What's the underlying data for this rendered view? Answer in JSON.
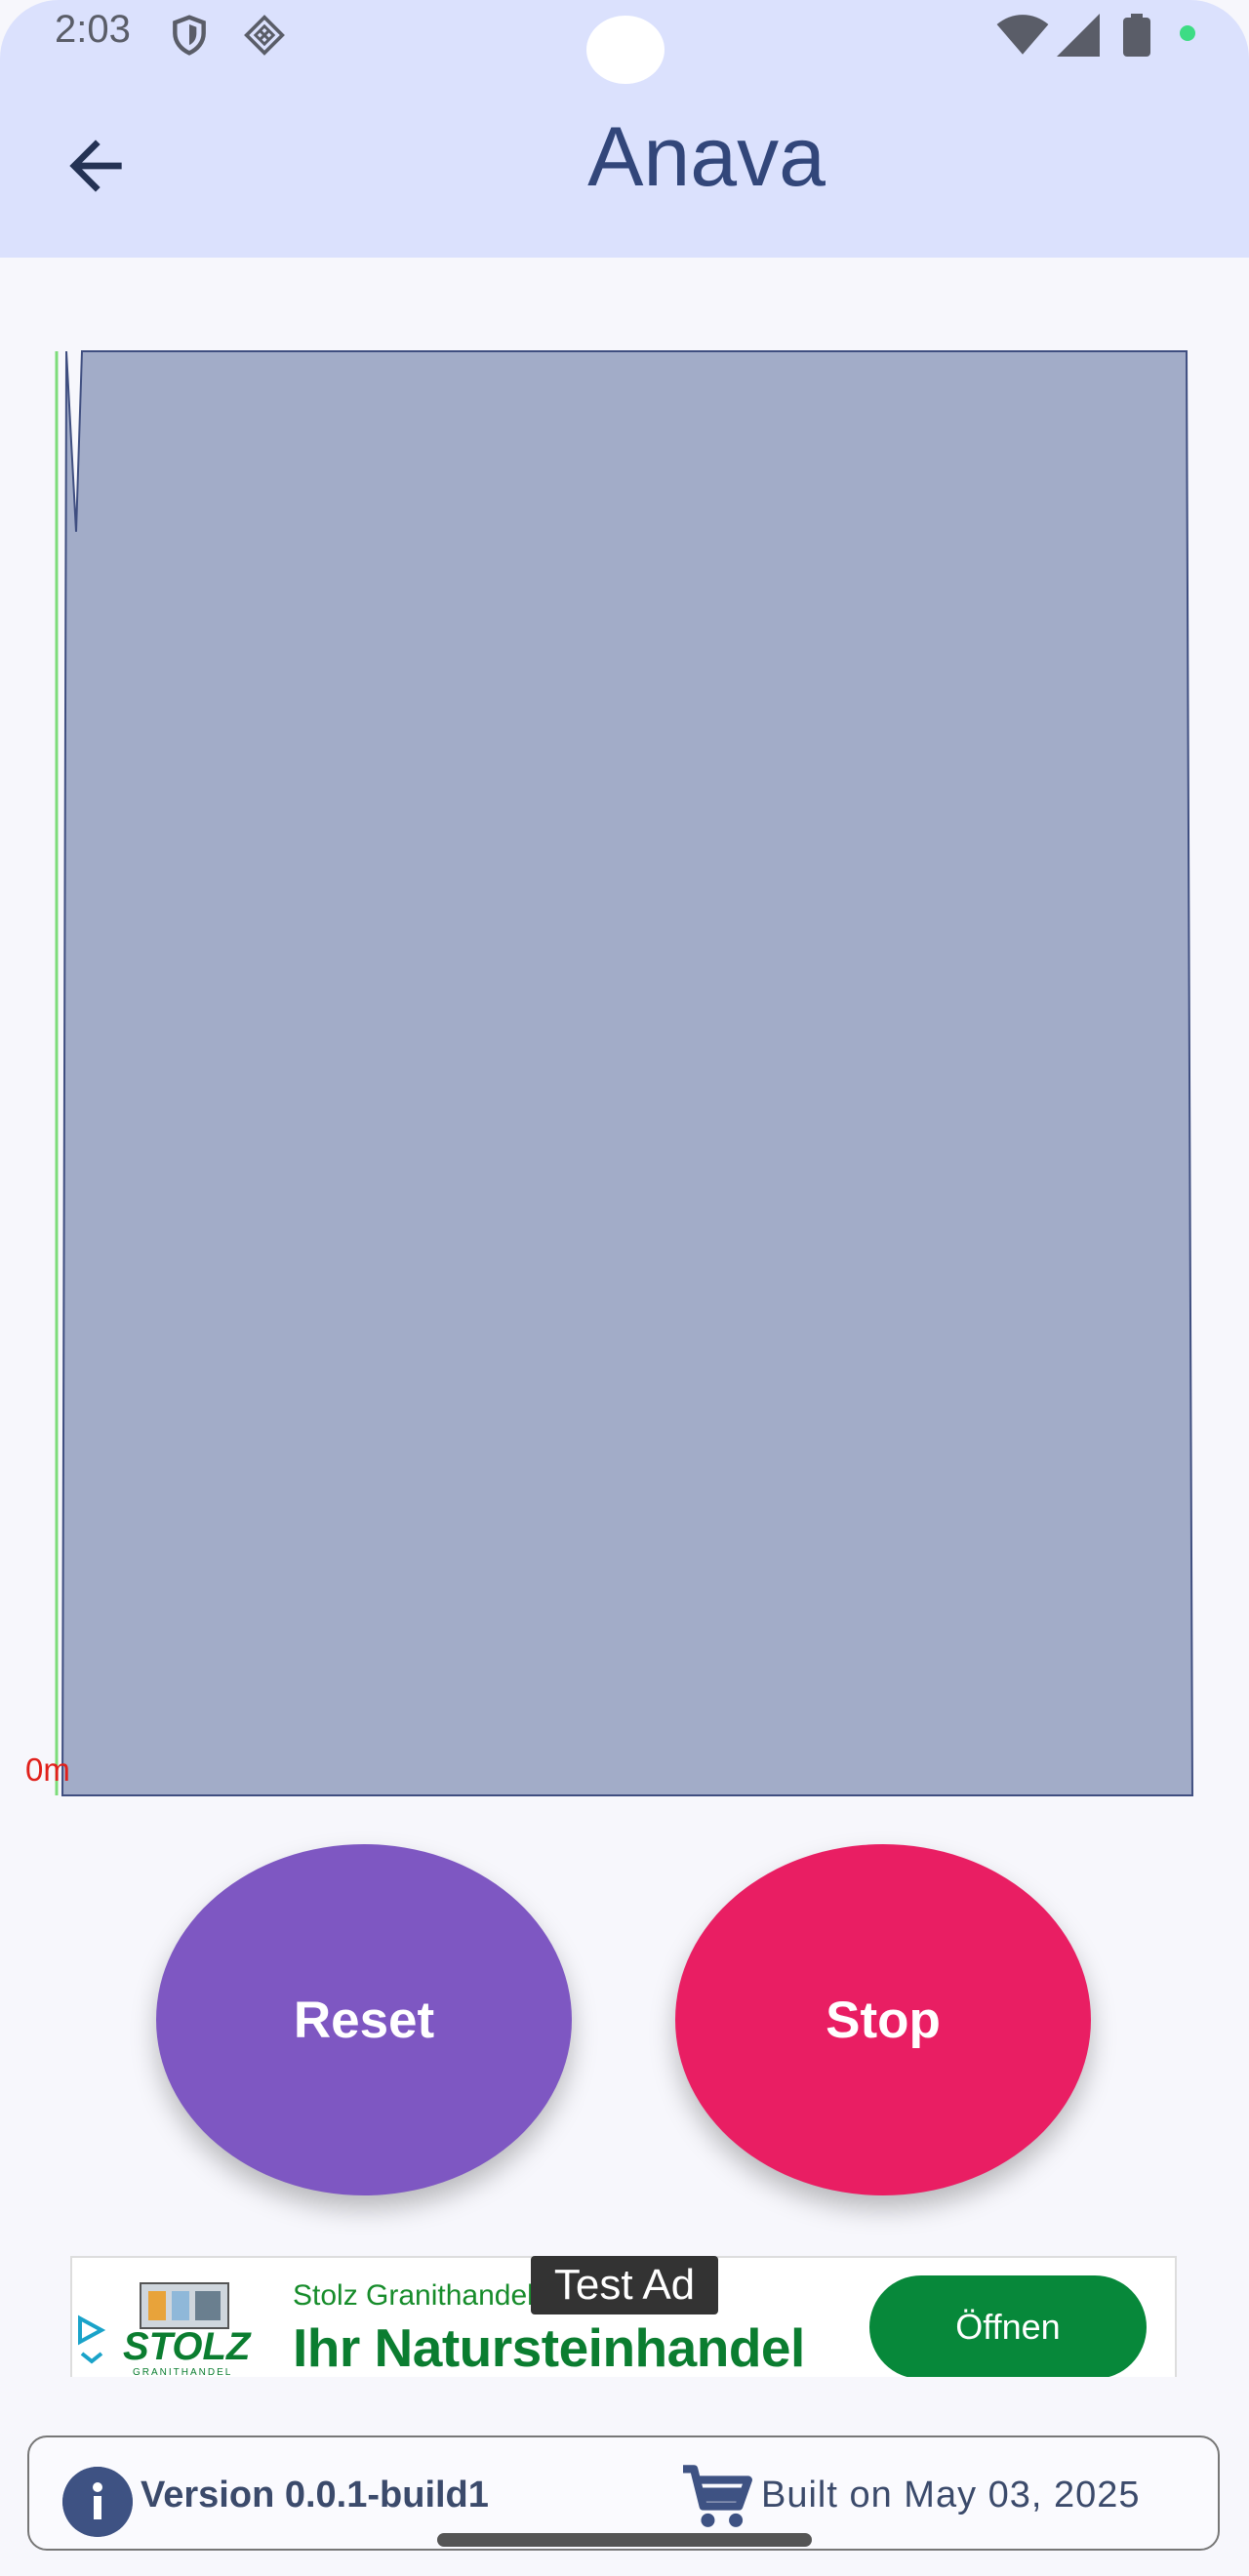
{
  "status_bar": {
    "time": "2:03"
  },
  "app_bar": {
    "title": "Anava"
  },
  "graph": {
    "zero_label": "0m",
    "fill_color": "#a2acc8",
    "line_color": "#3f4e80",
    "baseline_color": "#7ddc7a"
  },
  "buttons": {
    "reset": "Reset",
    "stop": "Stop"
  },
  "ad": {
    "badge": "Test Ad",
    "advertiser": "Stolz Granithandel",
    "headline": "Ihr Natursteinhandel",
    "cta": "Öffnen",
    "logo_text": "STOLZ",
    "logo_subtext": "GRANITHANDEL"
  },
  "footer": {
    "version": "Version 0.0.1-build1",
    "built": "Built on May 03, 2025"
  }
}
